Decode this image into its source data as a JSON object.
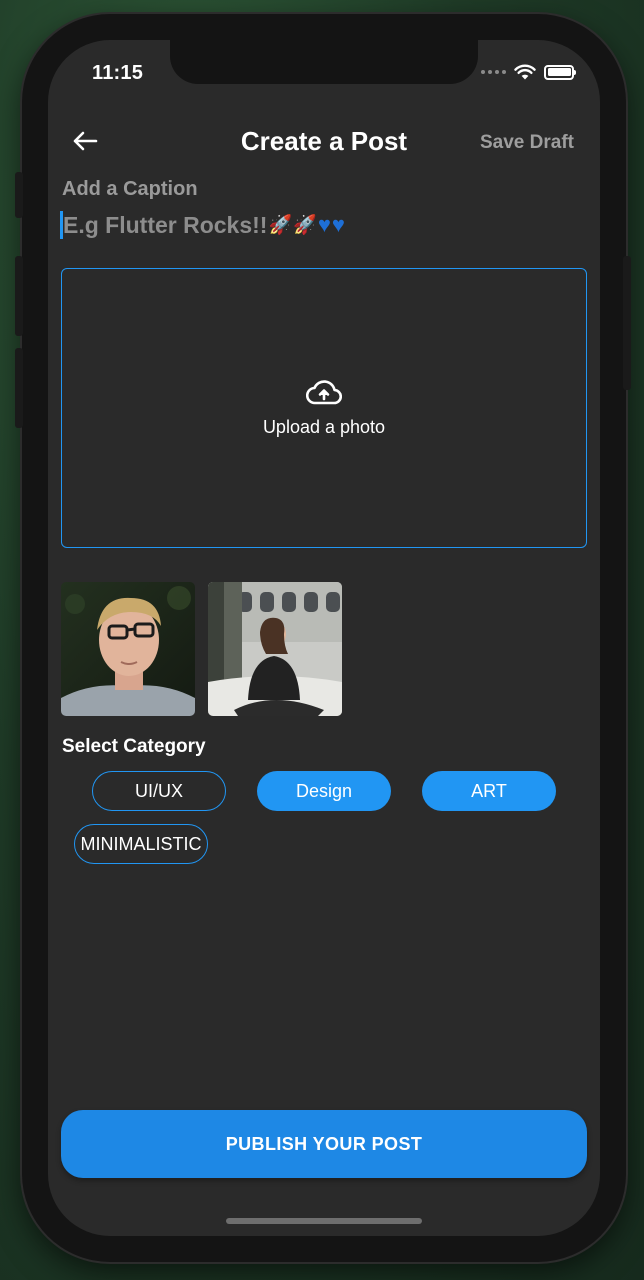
{
  "status_bar": {
    "time": "11:15"
  },
  "app_bar": {
    "title": "Create a Post",
    "save_draft_label": "Save Draft",
    "back_icon": "arrow-left-icon"
  },
  "caption": {
    "label": "Add a Caption",
    "placeholder": "E.g Flutter Rocks!!",
    "placeholder_emojis": [
      "rocket",
      "rocket",
      "blue-heart",
      "blue-heart"
    ]
  },
  "upload": {
    "label": "Upload a photo",
    "icon": "cloud-upload-icon"
  },
  "thumbnails": [
    {
      "name": "thumbnail-man-glasses"
    },
    {
      "name": "thumbnail-woman-sitting"
    }
  ],
  "category": {
    "label": "Select Category",
    "chips": [
      {
        "label": "UI/UX",
        "style": "outlined"
      },
      {
        "label": "Design",
        "style": "filled"
      },
      {
        "label": "ART",
        "style": "filled"
      },
      {
        "label": "MINIMALISTIC",
        "style": "outlined"
      }
    ]
  },
  "publish_button": {
    "label": "PUBLISH YOUR POST"
  },
  "colors": {
    "accent": "#2196f3",
    "background": "#2a2a2a",
    "publish": "#1e88e5"
  }
}
